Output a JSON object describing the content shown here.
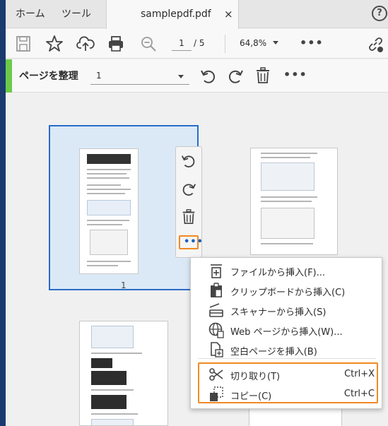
{
  "tabs": {
    "home": "ホーム",
    "tools": "ツール",
    "document": "samplepdf.pdf",
    "close": "×",
    "help": "?"
  },
  "toolbar": {
    "page_current": "1",
    "page_total": "/ 5",
    "zoom": "64,8%"
  },
  "organize": {
    "title": "ページを整理",
    "range": "1"
  },
  "pages": [
    {
      "number": "1"
    }
  ],
  "context_menu": {
    "items": [
      {
        "label": "ファイルから挿入(F)...",
        "icon": "insert-file-icon"
      },
      {
        "label": "クリップボードから挿入(C)",
        "icon": "clipboard-icon"
      },
      {
        "label": "スキャナーから挿入(S)",
        "icon": "scanner-icon"
      },
      {
        "label": "Web ページから挿入(W)...",
        "icon": "web-icon"
      },
      {
        "label": "空白ページを挿入(B)",
        "icon": "blank-page-icon"
      },
      {
        "label": "切り取り(T)",
        "shortcut": "Ctrl+X",
        "icon": "scissors-icon"
      },
      {
        "label": "コピー(C)",
        "shortcut": "Ctrl+C",
        "icon": "copy-icon"
      }
    ]
  },
  "colors": {
    "accent_green": "#6bc94a",
    "selection_blue": "#2a6cc8",
    "highlight_orange": "#f08a24",
    "link_blue": "#1a5fc0"
  }
}
